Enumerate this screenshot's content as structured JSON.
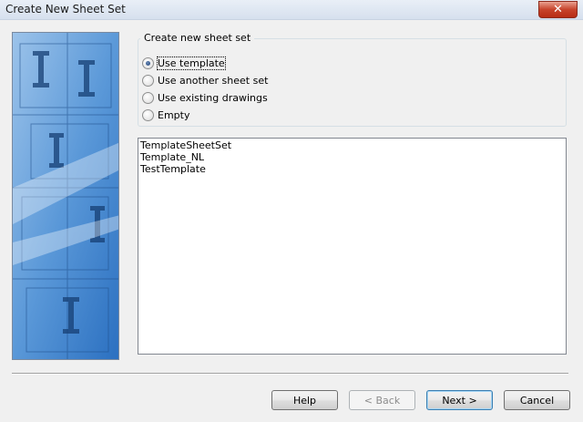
{
  "window": {
    "title": "Create New Sheet Set",
    "close_glyph": "✕"
  },
  "create_group": {
    "legend": "Create new sheet set",
    "options": [
      {
        "label": "Use template",
        "checked": true
      },
      {
        "label": "Use another sheet set",
        "checked": false
      },
      {
        "label": "Use existing drawings",
        "checked": false
      },
      {
        "label": "Empty",
        "checked": false
      }
    ]
  },
  "templates": {
    "items": [
      "TemplateSheetSet",
      "Template_NL",
      "TestTemplate"
    ]
  },
  "buttons": {
    "help": "Help",
    "back": "< Back",
    "next": "Next >",
    "cancel": "Cancel"
  },
  "colors": {
    "side_image_blue": "#3d7dc9",
    "close_red": "#c7432b"
  }
}
